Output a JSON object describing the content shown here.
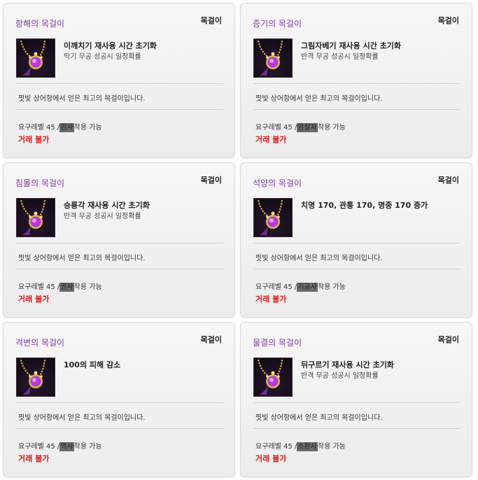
{
  "cards": [
    {
      "name": "항해의 목걸이",
      "type": "목걸이",
      "effect": "이깨치기 재사용 시간 초기화",
      "effect_sub": "막기 무공 성공시 일정확률",
      "desc": "찟빛 상어항에서 얻은 최고의 목걸이입니다.",
      "req_prefix": "요구레벨 45 /",
      "req_class": "검사",
      "req_suffix": "착용 가능",
      "trade": "거래 불가",
      "icon": "necklace-icon"
    },
    {
      "name": "증기의 목걸이",
      "type": "목걸이",
      "effect": "그림자베기 재사용 시간 초기화",
      "effect_sub": "반격 무공 성공시 일정확률",
      "desc": "찟빛 상어항에서 얻은 최고의 목걸이입니다.",
      "req_prefix": "요구레벨 45 /",
      "req_class": "암살자",
      "req_suffix": "착용 가능",
      "trade": "거래 불가",
      "icon": "necklace-icon"
    },
    {
      "name": "침몰의 목걸이",
      "type": "목걸이",
      "effect": "승룡각 재사용 시간 초기화",
      "effect_sub": "반격 무공 성공시 일정확률",
      "desc": "찟빛 상어항에서 얻은 최고의 목걸이입니다.",
      "req_prefix": "요구레벨 45 /",
      "req_class": "권사",
      "req_suffix": "착용 가능",
      "trade": "거래 불가",
      "icon": "necklace-icon"
    },
    {
      "name": "석양의 목걸이",
      "type": "목걸이",
      "effect": "치명 170, 관통 170, 명중 170 증가",
      "effect_sub": "",
      "desc": "찟빛 상어항에서 얻은 최고의 목걸이입니다.",
      "req_prefix": "요구레벨 45 /",
      "req_class": "기공사",
      "req_suffix": "착용 가능",
      "trade": "거래 불가",
      "icon": "necklace-icon"
    },
    {
      "name": "격변의 목걸이",
      "type": "목걸이",
      "effect": "100의 피해 감소",
      "effect_sub": "",
      "desc": "찟빛 상어항에서 얻은 최고의 목걸이입니다.",
      "req_prefix": "요구레벨 45 /",
      "req_class": "역사",
      "req_suffix": "착용 가능",
      "trade": "거래 불가",
      "icon": "necklace-icon"
    },
    {
      "name": "물결의 목걸이",
      "type": "목걸이",
      "effect": "뒤구르기 재사용 시간 초기화",
      "effect_sub": "반격 무공 성공시 일정확률",
      "desc": "찟빛 상어항에서 얻은 최고의 목걸이입니다.",
      "req_prefix": "요구레벨 45 /",
      "req_class": "소환사",
      "req_suffix": "착용 가능",
      "trade": "거래 불가",
      "icon": "necklace-icon"
    }
  ],
  "colors": {
    "title": "#7b3b9e",
    "trade": "#d21a1a",
    "class_bg": "#6b6b6b"
  }
}
